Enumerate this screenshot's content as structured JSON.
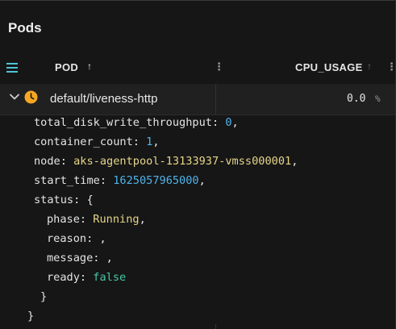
{
  "page": {
    "title": "Pods"
  },
  "columns": {
    "pod": {
      "label": "POD",
      "sort_icon": "↑",
      "menu_icon": "⋮"
    },
    "cpu": {
      "label": "CPU_USAGE",
      "sort_icon": "↑",
      "menu_icon": "⋮"
    }
  },
  "row": {
    "name": "default/liveness-http",
    "cpu_value": "0.0",
    "cpu_unit": "%",
    "status_color": "#f5a623"
  },
  "detail": {
    "total_disk_write_throughput": {
      "key": "total_disk_write_throughput",
      "value": "0"
    },
    "container_count": {
      "key": "container_count",
      "value": "1"
    },
    "node": {
      "key": "node",
      "value": "aks-agentpool-13133937-vmss000001"
    },
    "start_time": {
      "key": "start_time",
      "value": "1625057965000"
    },
    "status": {
      "key": "status",
      "phase": {
        "key": "phase",
        "value": "Running"
      },
      "reason": {
        "key": "reason",
        "value": ""
      },
      "message": {
        "key": "message",
        "value": ""
      },
      "ready": {
        "key": "ready",
        "value": "false"
      }
    }
  },
  "icons": {
    "menu": "hamburger-icon",
    "expand": "chevron-down-icon",
    "status": "clock-icon"
  },
  "colors": {
    "accent": "#4fc3d8",
    "number": "#4fb3ea",
    "string": "#e6d589",
    "boolean": "#46c8a6"
  }
}
